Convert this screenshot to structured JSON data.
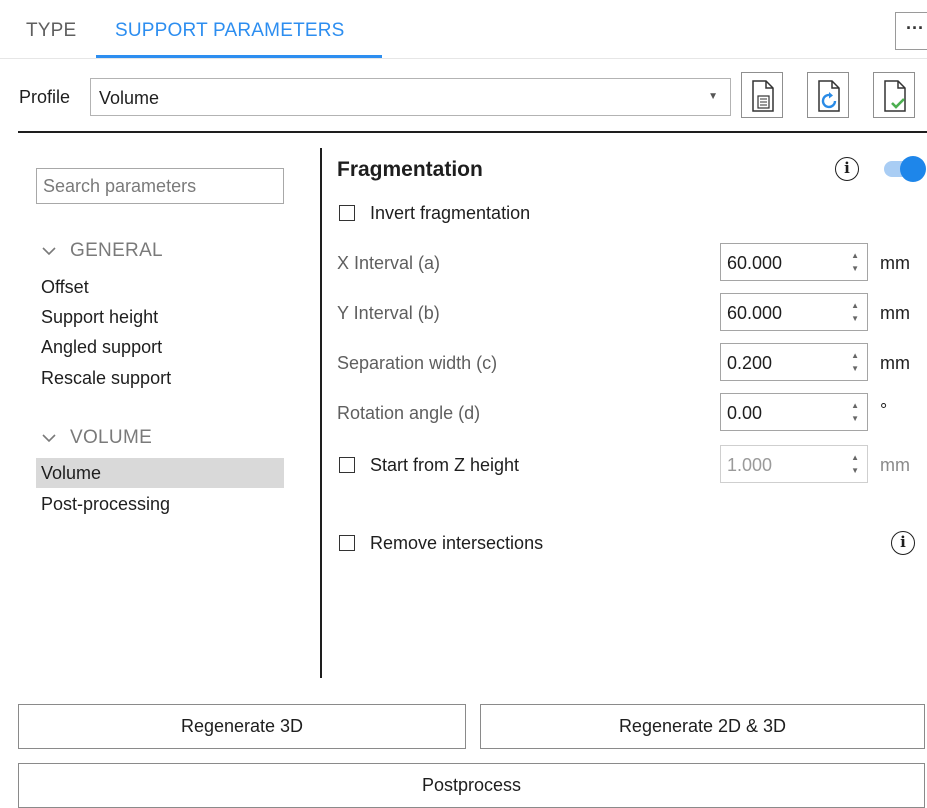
{
  "tabs": [
    {
      "label": "TYPE",
      "active": false
    },
    {
      "label": "SUPPORT PARAMETERS",
      "active": true
    }
  ],
  "more_label": "···",
  "profile": {
    "label": "Profile",
    "value": "Volume"
  },
  "icons": [
    "document-icon",
    "document-refresh-icon",
    "document-check-icon"
  ],
  "search": {
    "placeholder": "Search parameters"
  },
  "nav": {
    "groups": [
      {
        "title": "GENERAL",
        "items": [
          "Offset",
          "Support height",
          "Angled support",
          "Rescale support"
        ]
      },
      {
        "title": "VOLUME",
        "items": [
          "Volume",
          "Post-processing"
        ]
      }
    ],
    "selected": "Volume"
  },
  "fragmentation": {
    "title": "Fragmentation",
    "enabled": true,
    "invert_label": "Invert fragmentation",
    "invert_checked": false,
    "params": [
      {
        "label": "X Interval (a)",
        "value": "60.000",
        "unit": "mm"
      },
      {
        "label": "Y Interval (b)",
        "value": "60.000",
        "unit": "mm"
      },
      {
        "label": "Separation width (c)",
        "value": "0.200",
        "unit": "mm"
      },
      {
        "label": "Rotation angle (d)",
        "value": "0.00",
        "unit": "°"
      }
    ],
    "start_z": {
      "label": "Start from Z height",
      "checked": false,
      "value": "1.000",
      "unit": "mm"
    },
    "remove_intersections": {
      "label": "Remove intersections",
      "checked": false
    }
  },
  "buttons": {
    "regen3d": "Regenerate 3D",
    "regen2d3d": "Regenerate 2D & 3D",
    "postprocess": "Postprocess"
  },
  "colors": {
    "accent": "#2d8ef0",
    "toggle": "#1e86ea",
    "selected_bg": "#d9d9d9"
  }
}
